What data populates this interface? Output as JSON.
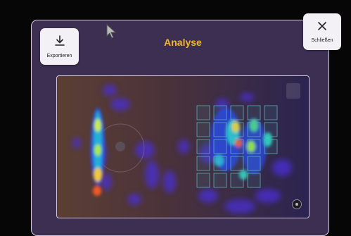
{
  "toolbar": {
    "export_label": "Exportieren",
    "close_label": "Schließen"
  },
  "dialog": {
    "title": "Analyse"
  },
  "colors": {
    "title": "#f5b52a",
    "panel": "#3c2f52",
    "button_bg": "#f3f1f5"
  },
  "icons": {
    "export": "download-icon",
    "close": "close-icon",
    "cursor": "cursor-icon"
  }
}
